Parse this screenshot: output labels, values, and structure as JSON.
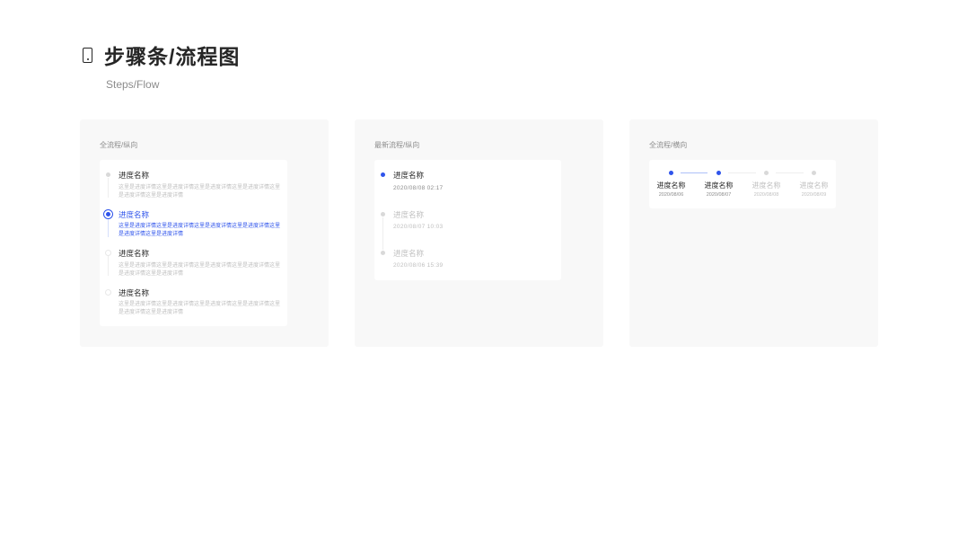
{
  "header": {
    "title": "步骤条/流程图",
    "subtitle": "Steps/Flow",
    "icon": "mobile-phone-icon"
  },
  "colors": {
    "accent": "#2f54eb",
    "inactive": "#d9d9d9",
    "panel_bg": "#f8f8f8"
  },
  "panels": [
    {
      "label": "全流程/纵向",
      "steps": [
        {
          "name": "进度名称",
          "desc": "这里是进度详情这里是进度详情这里是进度详情这里是进度详情这里是进度详情这里是进度详情",
          "state": "done"
        },
        {
          "name": "进度名称",
          "desc": "这里是进度详情这里是进度详情这里是进度详情这里是进度详情这里是进度详情这里是进度详情",
          "state": "active"
        },
        {
          "name": "进度名称",
          "desc": "这里是进度详情这里是进度详情这里是进度详情这里是进度详情这里是进度详情这里是进度详情",
          "state": "pending"
        },
        {
          "name": "进度名称",
          "desc": "这里是进度详情这里是进度详情这里是进度详情这里是进度详情这里是进度详情这里是进度详情",
          "state": "pending"
        }
      ]
    },
    {
      "label": "最新流程/纵向",
      "steps": [
        {
          "name": "进度名称",
          "date": "2020/08/08   02:17",
          "state": "latest"
        },
        {
          "name": "进度名称",
          "date": "2020/08/07   10:03",
          "state": "past"
        },
        {
          "name": "进度名称",
          "date": "2020/08/06   15:39",
          "state": "past"
        }
      ]
    },
    {
      "label": "全流程/横向",
      "steps": [
        {
          "name": "进度名称",
          "date": "2020/08/06",
          "state": "done"
        },
        {
          "name": "进度名称",
          "date": "2020/08/07",
          "state": "done"
        },
        {
          "name": "进度名称",
          "date": "2020/08/08",
          "state": "pending"
        },
        {
          "name": "进度名称",
          "date": "2020/08/09",
          "state": "pending"
        }
      ]
    }
  ]
}
